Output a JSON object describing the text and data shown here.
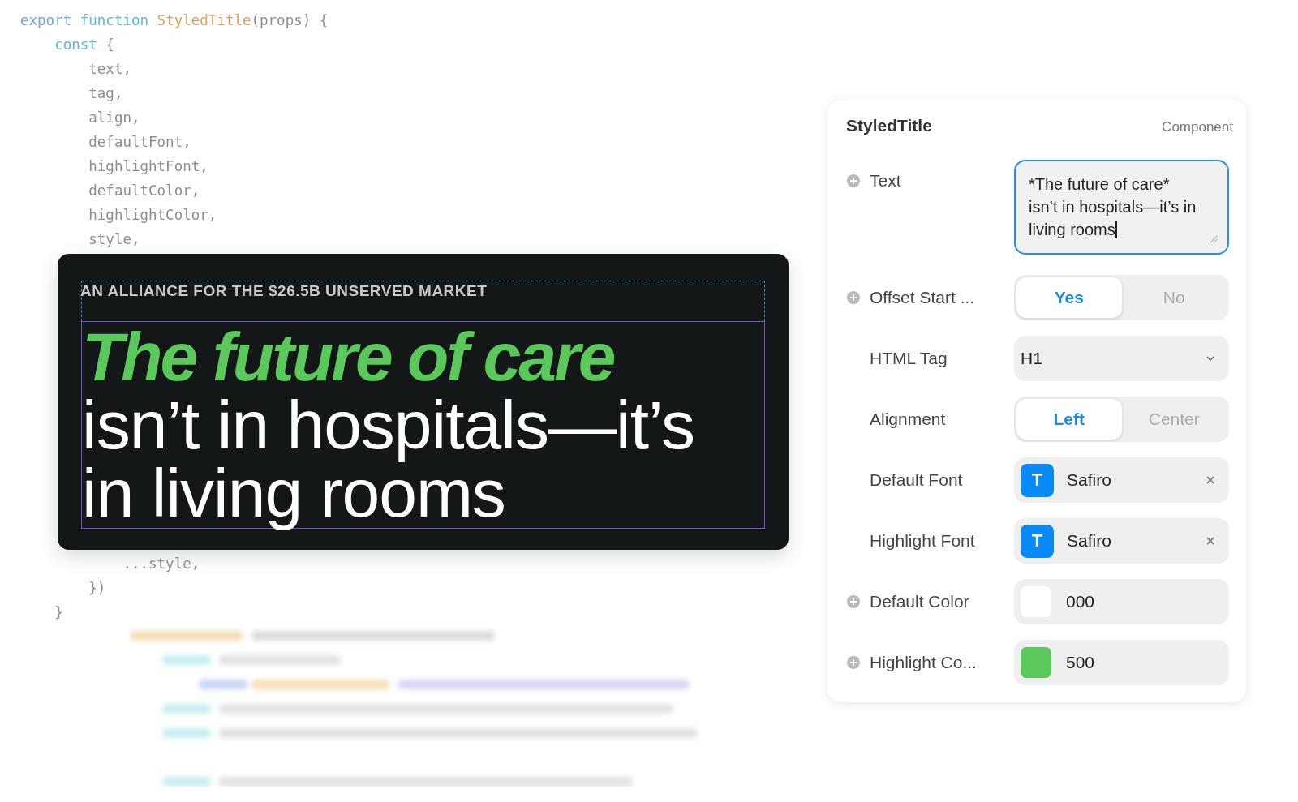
{
  "code_top": [
    {
      "tokens": [
        {
          "text": "export ",
          "kind": "keyword"
        },
        {
          "text": "function ",
          "kind": "decl"
        },
        {
          "text": "StyledTitle",
          "kind": "func"
        },
        {
          "text": "(props) {",
          "kind": "plain"
        }
      ]
    },
    {
      "tokens": [
        {
          "text": "    const ",
          "kind": "decl"
        },
        {
          "text": "{",
          "kind": "plain"
        }
      ]
    },
    {
      "tokens": [
        {
          "text": "        text,",
          "kind": "plain"
        }
      ]
    },
    {
      "tokens": [
        {
          "text": "        tag,",
          "kind": "plain"
        }
      ]
    },
    {
      "tokens": [
        {
          "text": "        align,",
          "kind": "plain"
        }
      ]
    },
    {
      "tokens": [
        {
          "text": "        defaultFont,",
          "kind": "plain"
        }
      ]
    },
    {
      "tokens": [
        {
          "text": "        highlightFont,",
          "kind": "plain"
        }
      ]
    },
    {
      "tokens": [
        {
          "text": "        defaultColor,",
          "kind": "plain"
        }
      ]
    },
    {
      "tokens": [
        {
          "text": "        highlightColor,",
          "kind": "plain"
        }
      ]
    },
    {
      "tokens": [
        {
          "text": "        style,",
          "kind": "plain"
        }
      ]
    }
  ],
  "code_bottom": [
    {
      "tokens": [
        {
          "text": "            ...style,",
          "kind": "plain"
        }
      ]
    },
    {
      "tokens": [
        {
          "text": "        })",
          "kind": "plain"
        }
      ]
    },
    {
      "tokens": [
        {
          "text": "    }",
          "kind": "plain"
        }
      ]
    }
  ],
  "preview": {
    "eyebrow": "AN ALLIANCE FOR THE $26.5B UNSERVED MARKET",
    "title_lines": [
      {
        "text": "The future of care",
        "highlight": true
      },
      {
        "text": "isn’t in hospitals—it’s",
        "highlight": false
      },
      {
        "text": "in living rooms",
        "highlight": false
      }
    ]
  },
  "panel": {
    "title": "StyledTitle",
    "subtitle": "Component",
    "rows": [
      {
        "kind": "textarea",
        "label": "Text",
        "addable": true,
        "value": "*The future of care* isn’t in hospitals—it’s in living rooms",
        "focused": true
      },
      {
        "kind": "segmented",
        "label": "Offset Start ...",
        "addable": true,
        "options": [
          {
            "label": "Yes",
            "selected": true
          },
          {
            "label": "No",
            "selected": false
          }
        ]
      },
      {
        "kind": "select",
        "label": "HTML Tag",
        "addable": false,
        "value": "H1"
      },
      {
        "kind": "segmented",
        "label": "Alignment",
        "addable": false,
        "options": [
          {
            "label": "Left",
            "selected": true
          },
          {
            "label": "Center",
            "selected": false
          }
        ]
      },
      {
        "kind": "font",
        "label": "Default Font",
        "addable": false,
        "value": "Safiro",
        "icon_letter": "T"
      },
      {
        "kind": "font",
        "label": "Highlight Font",
        "addable": false,
        "value": "Safiro",
        "icon_letter": "T"
      },
      {
        "kind": "color",
        "label": "Default Color",
        "addable": true,
        "value": "000",
        "color": "#ffffff"
      },
      {
        "kind": "color",
        "label": "Highlight Co...",
        "addable": true,
        "value": "500",
        "color": "#5ac85a"
      }
    ]
  }
}
